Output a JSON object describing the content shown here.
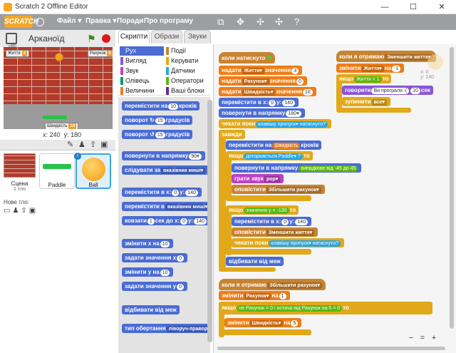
{
  "window": {
    "title": "Scratch 2 Offline Editor",
    "min": "—",
    "max": "☐",
    "close": "✕"
  },
  "menu": {
    "logo": "SCRATCH",
    "items": [
      "Файл ▾",
      "Правка ▾",
      "Поради",
      "Про програму"
    ]
  },
  "stage": {
    "project_name": "Арканоїд",
    "hud_lives_label": "Життя",
    "hud_lives_value": "3",
    "hud_score_label": "Рахунок",
    "hud_score_value": "0",
    "hud_speed_label": "Швидкість",
    "hud_speed_value": "10",
    "x_label": "x:",
    "x_value": "240",
    "y_label": "y:",
    "y_value": "180",
    "corner_label": "x480"
  },
  "sprites": {
    "scene_label": "Сцена",
    "scene_sub": "1 тло",
    "new_bg_label": "Нове тло:",
    "items": [
      {
        "name": "Paddle"
      },
      {
        "name": "Ball"
      }
    ]
  },
  "tabs": [
    {
      "label": "Скрипти"
    },
    {
      "label": "Образи"
    },
    {
      "label": "Звуки"
    }
  ],
  "categories": [
    {
      "label": "Рух",
      "color": "#4a6cd4"
    },
    {
      "label": "Події",
      "color": "#c88330"
    },
    {
      "label": "Вигляд",
      "color": "#8a55d7"
    },
    {
      "label": "Керувати",
      "color": "#e1a91a"
    },
    {
      "label": "Звук",
      "color": "#bb42c3"
    },
    {
      "label": "Датчики",
      "color": "#2ca5e2"
    },
    {
      "label": "Олівець",
      "color": "#0e9a6c"
    },
    {
      "label": "Оператори",
      "color": "#5cb712"
    },
    {
      "label": "Величини",
      "color": "#ee7d16"
    },
    {
      "label": "Ваші блоки",
      "color": "#632d99"
    }
  ],
  "palette": {
    "b1": "перемістити на",
    "b1v": "10",
    "b1s": "кроків",
    "b2": "поворот ↻",
    "b2v": "15",
    "b2s": "градусів",
    "b3": "поворот ↺",
    "b3v": "15",
    "b3s": "градусів",
    "b4": "повернути в напрямку",
    "b4v": "90▾",
    "b5": "слідувати за",
    "b5v": "вказівник миші▾",
    "b6": "перемістити в x:",
    "b6v": "0",
    "b6y": "y:",
    "b6yv": "140",
    "b7": "перемістити в",
    "b7v": "вказівник миші▾",
    "b8": "ковзати",
    "b8v": "1",
    "b8s": "сек до x:",
    "b8x": "0",
    "b8y": "y:",
    "b8yv": "140",
    "b9": "змінити х на",
    "b9v": "10",
    "b10": "задати значення х",
    "b10v": "0",
    "b11": "змінити у на",
    "b11v": "10",
    "b12": "задати значення у",
    "b12v": "0",
    "b13": "відбивати від меж",
    "b14": "тип обертання",
    "b14v": "ліворуч-праворуч▾"
  },
  "script1": {
    "hat": "коли натиснуто",
    "s1": "надати",
    "s1v": "Життя▾",
    "s1s": "значення",
    "s1n": "3",
    "s2": "надати",
    "s2v": "Рахунок▾",
    "s2s": "значення",
    "s2n": "0",
    "s3": "надати",
    "s3v": "Швидкість▾",
    "s3s": "значення",
    "s3n": "10",
    "s4": "перемістити в x:",
    "s4v": "0",
    "s4y": "y:",
    "s4yv": "140",
    "s5": "повернути в напрямку",
    "s5v": "180▾",
    "s6": "чекати поки",
    "s6k": "клавішу",
    "s6kv": "пропуск▾",
    "s6e": "натиснуто?",
    "s7": "завжди",
    "s8": "перемістити на",
    "s8v": "Швидкість",
    "s8s": "кроків",
    "s9": "якщо",
    "s9c": "доторкається",
    "s9cv": "Paddle▾",
    "s9q": "?",
    "s9t": "то",
    "s10": "повернути в напрямку",
    "s10v": "випадкове від",
    "s10a": "-45",
    "s10b": "до",
    "s10c": "45",
    "s11": "грати звук",
    "s11v": "pop▾",
    "s12": "оповістити",
    "s12v": "Збільшити рахунок▾",
    "s13": "якщо",
    "s13v": "значення у",
    "s13lt": "<",
    "s13n": "-130",
    "s13t": "то",
    "s14": "перемістити в x:",
    "s14v": "0",
    "s14y": "y:",
    "s14yv": "140",
    "s15": "оповістити",
    "s15v": "Зменшити життя▾",
    "s16": "чекати поки",
    "s16k": "клавішу",
    "s16kv": "пропуск▾",
    "s16e": "натиснуто?",
    "s17": "відбивати від меж"
  },
  "script2": {
    "hat": "коли я отримаю",
    "hatv": "Зменшити життя▾",
    "s1": "змінити",
    "s1v": "Життя▾",
    "s1s": "на",
    "s1n": "-1",
    "s2": "якщо",
    "s2v": "Життя",
    "s2lt": "<",
    "s2n": "1",
    "s2t": "то",
    "s3": "говорити",
    "s3v": "Ви програли :(",
    "s3n": "10",
    "s3s": "сек",
    "s4": "зупинити",
    "s4v": "все▾"
  },
  "script3": {
    "hat": "коли я отримаю",
    "hatv": "Збільшити рахунок▾",
    "s1": "змінити",
    "s1v": "Рахунок▾",
    "s1s": "на",
    "s1n": "1",
    "s2": "якщо",
    "s2n": "не",
    "s2v": "Рахунок",
    "s2eq": "=",
    "s2z": "0",
    "s2and": "і",
    "s2mod": "остача від",
    "s2r": "Рахунок",
    "s2on": "на",
    "s2five": "5",
    "s2eq2": "=",
    "s2z2": "0",
    "s2t": "то",
    "s3": "змінити",
    "s3v": "Швидкість▾",
    "s3s": "на",
    "s3n": "5"
  },
  "scripts_area": {
    "xy_x": "x: 0",
    "xy_y": "y: 140"
  },
  "zoom": {
    "out": "−",
    "reset": "=",
    "in": "+"
  }
}
